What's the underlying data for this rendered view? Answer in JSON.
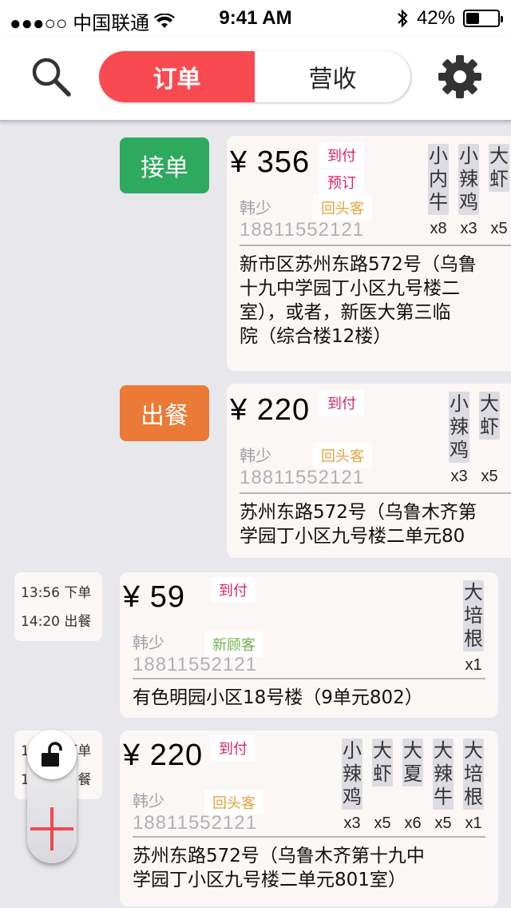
{
  "status_bar": {
    "carrier": "●●●○○ 中国联通",
    "time": "9:41 AM",
    "battery": "42%",
    "battery_level": 0.42
  },
  "nav": {
    "search_icon": "search-icon",
    "tabs": [
      {
        "label": "订单",
        "active": true
      },
      {
        "label": "营收",
        "active": false
      }
    ],
    "settings_icon": "gear-icon"
  },
  "colors": {
    "accent_red": "#f94a51",
    "accept_green": "#2eaa5e",
    "serve_orange": "#ea7a35"
  },
  "orders": [
    {
      "action": "接单",
      "price": "¥ 356",
      "tags": [
        "到付",
        "预订"
      ],
      "customer_tag": "回头客",
      "name": "韩少",
      "phone": "18811552121",
      "address": [
        "新市区苏州东路572号（乌鲁",
        "十九中学园丁小区九号楼二",
        "室），或者，新医大第三临",
        "院（综合楼12楼）"
      ],
      "items": [
        {
          "name": [
            "小",
            "内",
            "牛"
          ],
          "qty": "x8"
        },
        {
          "name": [
            "小",
            "辣",
            "鸡"
          ],
          "qty": "x3"
        },
        {
          "name": [
            "大",
            "虾"
          ],
          "qty": "x5"
        }
      ]
    },
    {
      "action": "出餐",
      "price": "¥ 220",
      "tags": [
        "到付"
      ],
      "customer_tag": "回头客",
      "name": "韩少",
      "phone": "18811552121",
      "address": [
        "苏州东路572号（乌鲁木齐第",
        "学园丁小区九号楼二单元80"
      ],
      "items": [
        {
          "name": [
            "小",
            "辣",
            "鸡"
          ],
          "qty": "x3"
        },
        {
          "name": [
            "大",
            "虾"
          ],
          "qty": "x5"
        }
      ]
    },
    {
      "time_order": "13:56 下单",
      "time_serve": "14:20 出餐",
      "price": "¥ 59",
      "tags": [
        "到付"
      ],
      "customer_tag": "新顾客",
      "name": "韩少",
      "phone": "18811552121",
      "address": [
        "有色明园小区18号楼（9单元802）"
      ],
      "items": [
        {
          "name": [
            "大",
            "培",
            "根"
          ],
          "qty": "x1"
        }
      ]
    },
    {
      "time_order": "13:56 下单",
      "time_serve": "14:20 出餐",
      "price": "¥ 220",
      "tags": [
        "到付"
      ],
      "customer_tag": "回头客",
      "name": "韩少",
      "phone": "18811552121",
      "address": [
        "苏州东路572号（乌鲁木齐第十九中",
        "学园丁小区九号楼二单元801室）"
      ],
      "items": [
        {
          "name": [
            "小",
            "辣",
            "鸡"
          ],
          "qty": "x3"
        },
        {
          "name": [
            "大",
            "虾"
          ],
          "qty": "x5"
        },
        {
          "name": [
            "大",
            "夏"
          ],
          "qty": "x6"
        },
        {
          "name": [
            "大",
            "辣",
            "牛"
          ],
          "qty": "x5"
        },
        {
          "name": [
            "大",
            "培",
            "根"
          ],
          "qty": "x1"
        }
      ]
    }
  ],
  "float_tools": {
    "lock_icon": "unlock-icon",
    "add_icon": "plus-icon"
  }
}
